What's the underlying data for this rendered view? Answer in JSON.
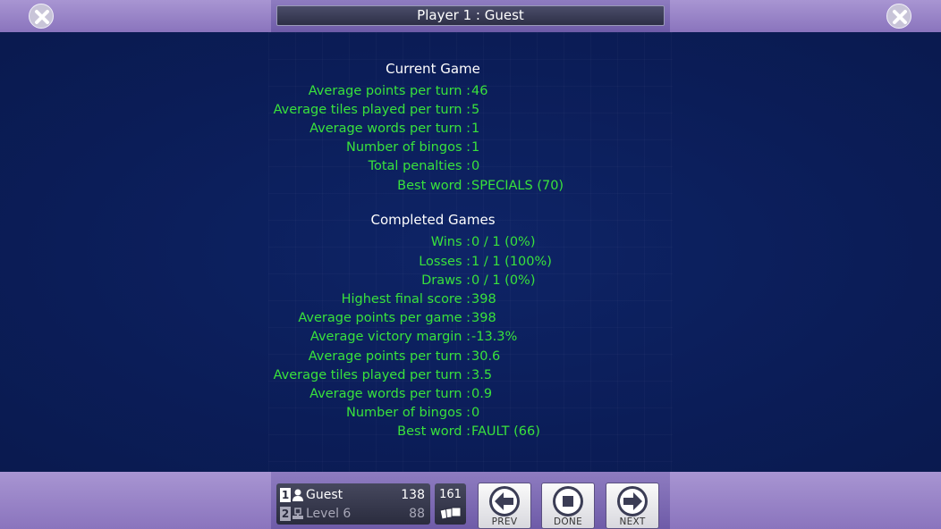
{
  "header": {
    "title": "Player 1 : Guest"
  },
  "current_game": {
    "title": "Current Game",
    "rows": [
      {
        "label": "Average points per turn",
        "value": "46"
      },
      {
        "label": "Average tiles played per turn",
        "value": "5"
      },
      {
        "label": "Average words per turn",
        "value": "1"
      },
      {
        "label": "Number of bingos",
        "value": "1"
      },
      {
        "label": "Total penalties",
        "value": "0"
      },
      {
        "label": "Best word",
        "value": "SPECIALS (70)"
      }
    ]
  },
  "completed_games": {
    "title": "Completed Games",
    "rows": [
      {
        "label": "Wins",
        "value": "0 / 1 (0%)"
      },
      {
        "label": "Losses",
        "value": "1 / 1 (100%)"
      },
      {
        "label": "Draws",
        "value": "0 / 1 (0%)"
      },
      {
        "label": "Highest final score",
        "value": "398"
      },
      {
        "label": "Average points per game",
        "value": "398"
      },
      {
        "label": "Average victory margin",
        "value": "-13.3%"
      },
      {
        "label": "Average points per turn",
        "value": "30.6"
      },
      {
        "label": "Average tiles played per turn",
        "value": "3.5"
      },
      {
        "label": "Average words per turn",
        "value": "0.9"
      },
      {
        "label": "Number of bingos",
        "value": "0"
      },
      {
        "label": "Best word",
        "value": "FAULT (66)"
      }
    ]
  },
  "players": [
    {
      "badge": "1",
      "icon": "person-icon",
      "name": "Guest",
      "score": "138"
    },
    {
      "badge": "2",
      "icon": "computer-icon",
      "name": "Level 6",
      "score": "88"
    }
  ],
  "tile_bag": {
    "count": "161",
    "icon": "tiles-icon"
  },
  "buttons": {
    "prev": "PREV",
    "done": "DONE",
    "next": "NEXT"
  },
  "colors": {
    "stat_text": "#39e23c",
    "board_bg": "#0c1f5c",
    "frame": "#8a74bd"
  }
}
